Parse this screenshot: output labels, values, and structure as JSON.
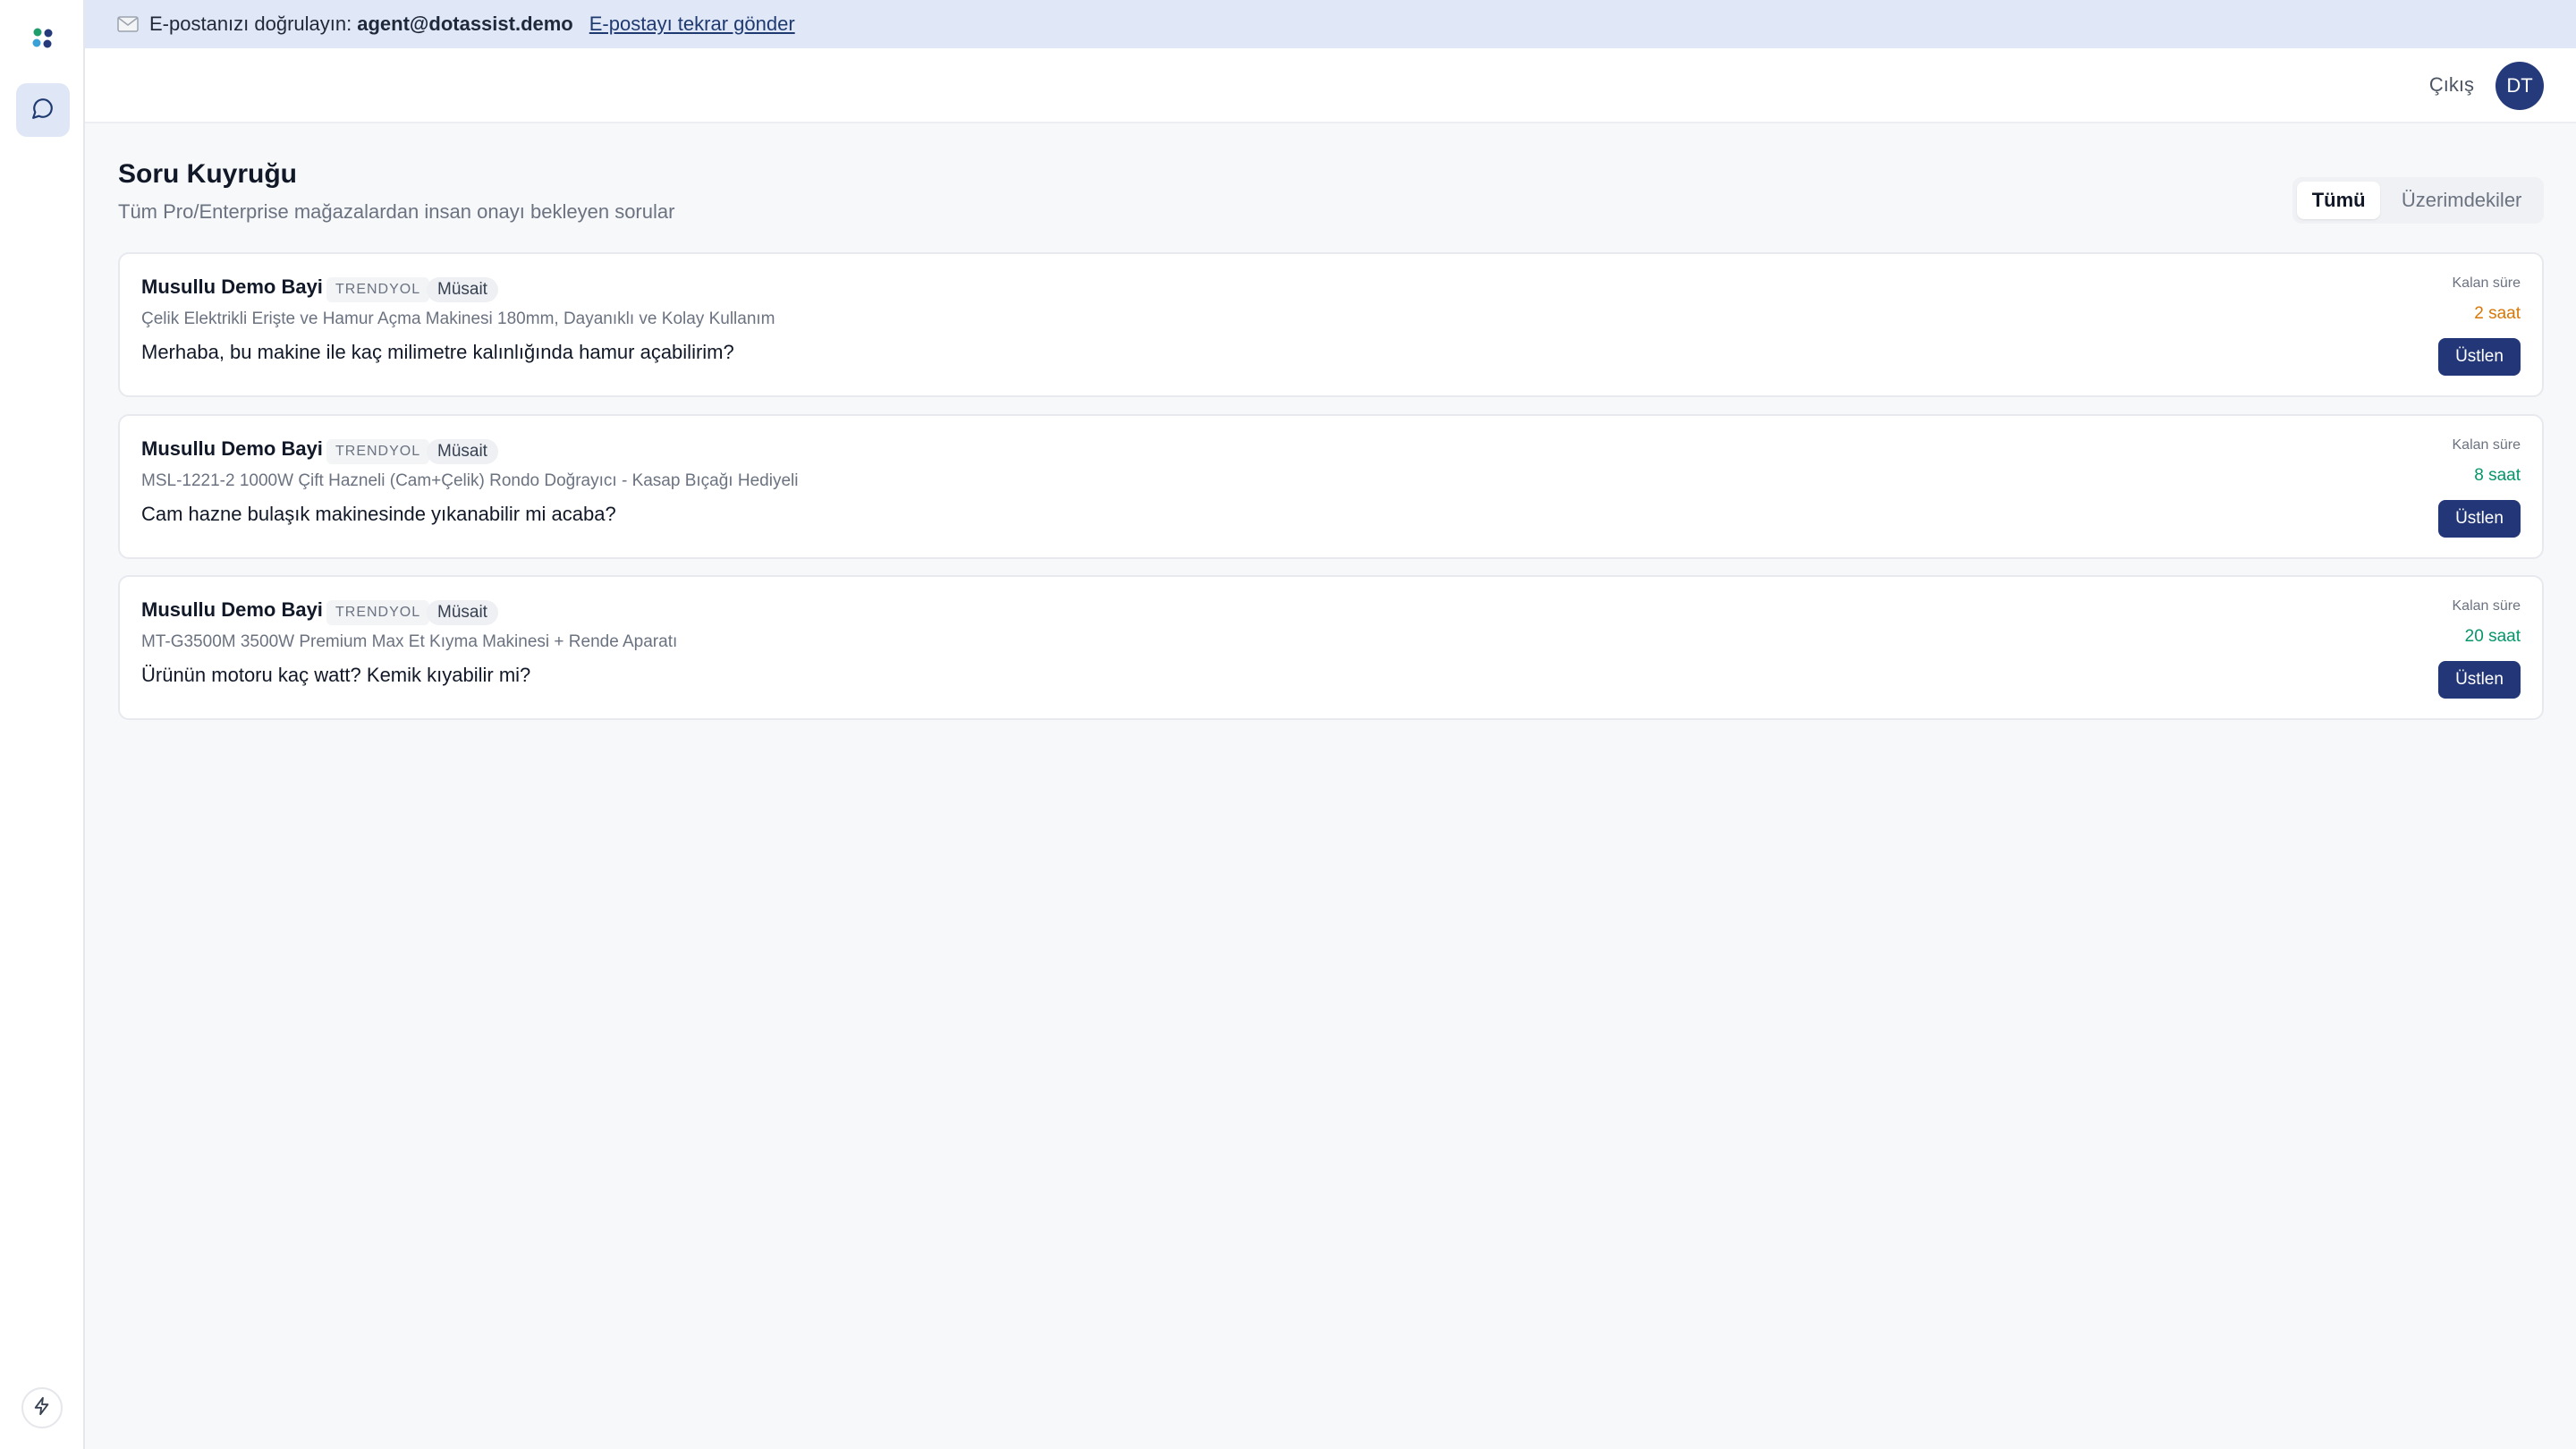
{
  "banner": {
    "prefix": "E-postanızı doğrulayın:",
    "email": "agent@dotassist.demo",
    "resend_link": "E-postayı tekrar gönder",
    "icon": "mail-icon"
  },
  "header": {
    "logout_label": "Çıkış",
    "avatar_initials": "DT"
  },
  "sidebar": {
    "items": [
      {
        "icon": "chat-icon",
        "active": true
      }
    ],
    "bottom_icon": "bolt-icon"
  },
  "page": {
    "title": "Soru Kuyruğu",
    "subtitle": "Tüm Pro/Enterprise mağazalardan insan onayı bekleyen sorular"
  },
  "filter": {
    "tabs": [
      {
        "label": "Tümü",
        "active": true
      },
      {
        "label": "Üzerimdekiler",
        "active": false
      }
    ]
  },
  "queue": [
    {
      "store": "Musullu Demo Bayi",
      "platform": "TRENDYOL",
      "status": "Müsait",
      "product": "Çelik Elektrikli Erişte ve Hamur Açma Makinesi 180mm, Dayanıklı ve Kolay Kullanım",
      "question": "Merhaba, bu makine ile kaç milimetre kalınlığında hamur açabilirim?",
      "time_label": "Kalan süre",
      "time_value": "2 saat",
      "time_color": "#d97706",
      "claim_label": "Üstlen"
    },
    {
      "store": "Musullu Demo Bayi",
      "platform": "TRENDYOL",
      "status": "Müsait",
      "product": "MSL-1221-2 1000W Çift Hazneli (Cam+Çelik) Rondo Doğrayıcı - Kasap Bıçağı Hediyeli",
      "question": "Cam hazne bulaşık makinesinde yıkanabilir mi acaba?",
      "time_label": "Kalan süre",
      "time_value": "8 saat",
      "time_color": "#059669",
      "claim_label": "Üstlen"
    },
    {
      "store": "Musullu Demo Bayi",
      "platform": "TRENDYOL",
      "status": "Müsait",
      "product": "MT-G3500M 3500W Premium Max Et Kıyma Makinesi + Rende Aparatı",
      "question": "Ürünün motoru kaç watt? Kemik kıyabilir mi?",
      "time_label": "Kalan süre",
      "time_value": "20 saat",
      "time_color": "#059669",
      "claim_label": "Üstlen"
    }
  ],
  "colors": {
    "accent": "#233778",
    "banner_bg": "#e0e7f6",
    "page_bg": "#f7f8fa"
  }
}
